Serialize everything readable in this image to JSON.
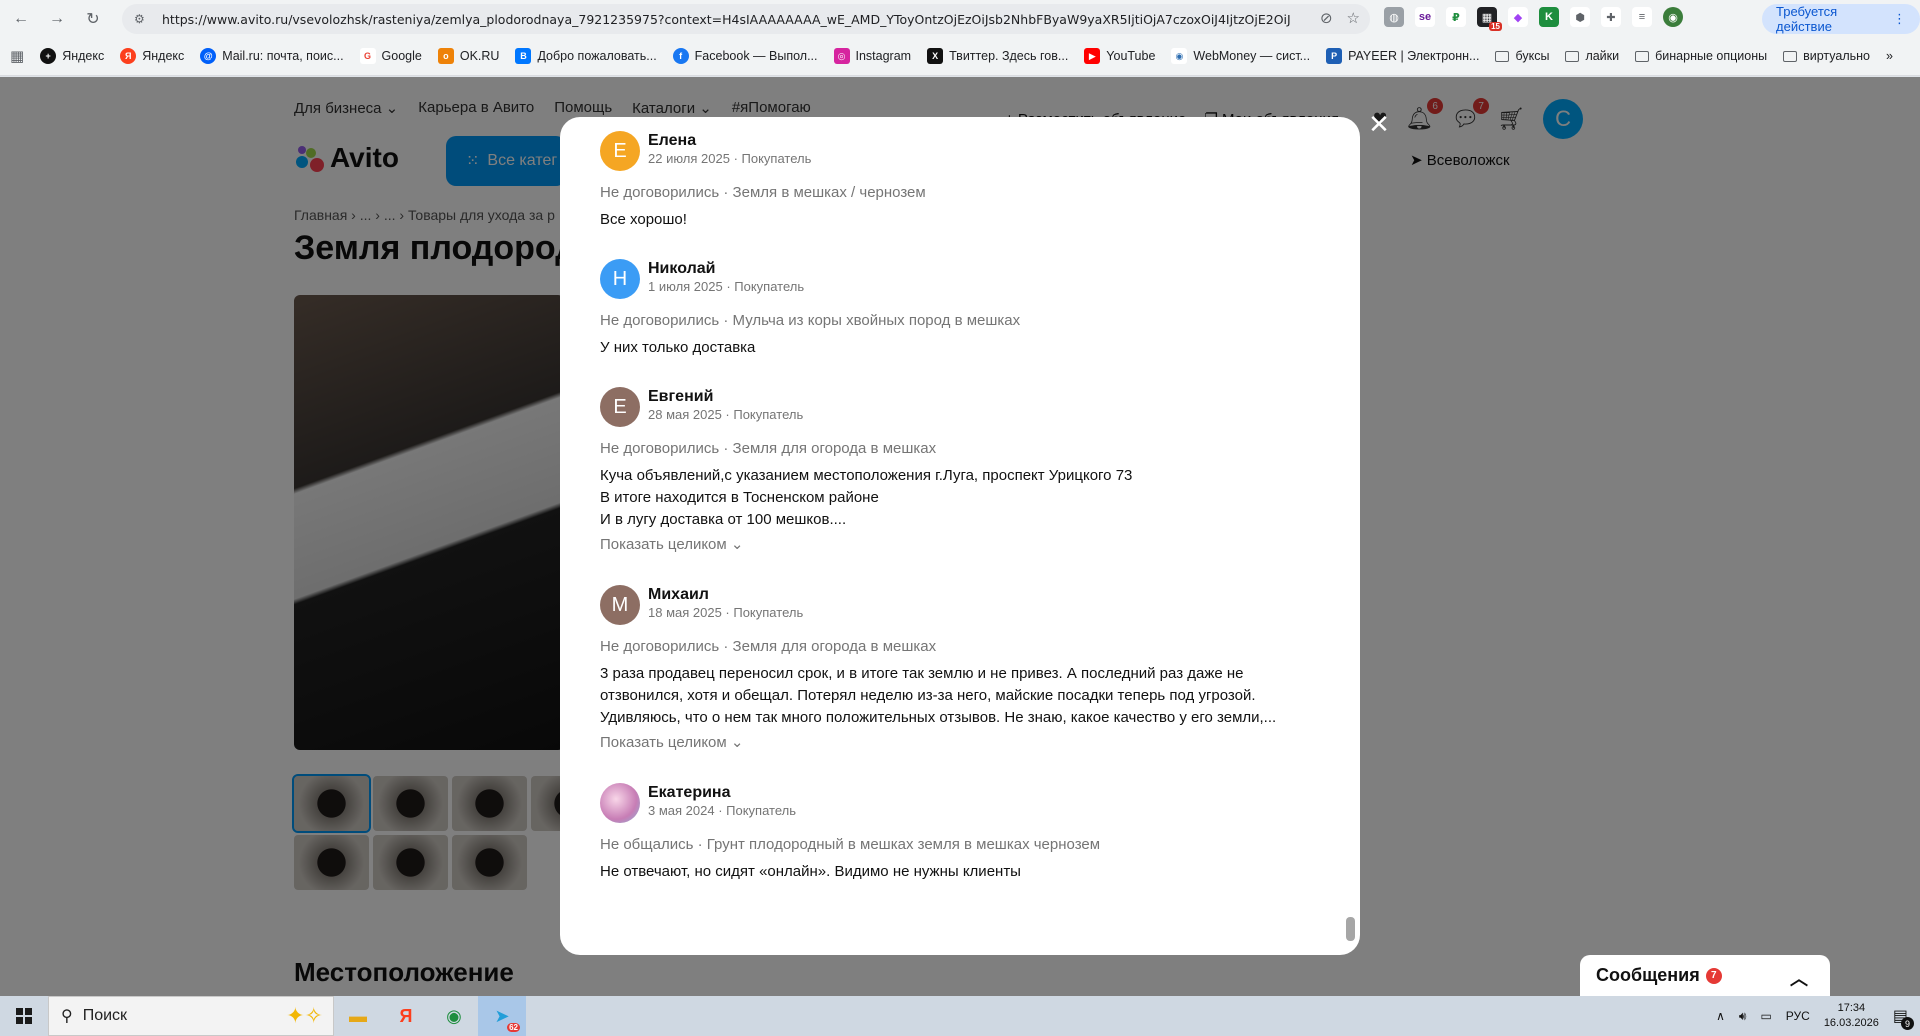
{
  "browser": {
    "url": "https://www.avito.ru/vsevolozhsk/rasteniya/zemlya_plodorodnaya_7921235975?context=H4sIAAAAAAAA_wE_AMD_YToyOntzOjEzOiJsb2NhbFByaW9yaXR5IjtiOjA7czoxOiJ4IjtzOjE2OiJ...",
    "action_label": "Требуется действие",
    "bookmarks": [
      "Яндекс",
      "Яндекс",
      "Mail.ru: почта, поис...",
      "Google",
      "OK.RU",
      "Добро пожаловать...",
      "Facebook — Выпол...",
      "Instagram",
      "Твиттер. Здесь гов...",
      "YouTube",
      "WebMoney — сист...",
      "PAYEER | Электронн...",
      "буксы",
      "лайки",
      "бинарные опционы",
      "виртуально"
    ],
    "ext_badge_1": "15"
  },
  "page": {
    "topnav": [
      "Для бизнеса ⌄",
      "Карьера в Авито",
      "Помощь",
      "Каталоги ⌄",
      "#яПомогаю"
    ],
    "post_ad": "+ Разместить объявление",
    "my_ads": "❐ Мои объявления",
    "notif_count": "6",
    "msg_count": "7",
    "user_initial": "C",
    "logo": "Avito",
    "categories": "Все катег",
    "location": "➤ Всеволожск",
    "breadcrumbs": "Главная › ... › ... › Товары для ухода за р",
    "title": "Земля плодород",
    "location_heading": "Местоположение"
  },
  "reviews": [
    {
      "initial": "Е",
      "color": "#f5a623",
      "name": "Елена",
      "meta": "22 июля 2025 · Покупатель",
      "deal": "Не договорились · Земля в мешках / чернозем",
      "text": [
        "Все хорошо!"
      ],
      "more": ""
    },
    {
      "initial": "Н",
      "color": "#3b9cf5",
      "name": "Николай",
      "meta": "1 июля 2025 · Покупатель",
      "deal": "Не договорились · Мульча из коры хвойных пород в мешках",
      "text": [
        "У них только доставка"
      ],
      "more": ""
    },
    {
      "initial": "Е",
      "color": "#8d6e63",
      "name": "Евгений",
      "meta": "28 мая 2025 · Покупатель",
      "deal": "Не договорились · Земля для огорода в мешках",
      "text": [
        "Куча объявлений,с указанием местоположения г.Луга, проспект Урицкого 73",
        "В итоге находится в Тосненском районе",
        "И в лугу доставка от 100 мешков...."
      ],
      "more": "Показать целиком ⌄"
    },
    {
      "initial": "М",
      "color": "#8d6e63",
      "name": "Михаил",
      "meta": "18 мая 2025 · Покупатель",
      "deal": "Не договорились · Земля для огорода в мешках",
      "text": [
        "3 раза продавец переносил срок, и в итоге так землю и не привез. А последний раз даже не",
        "отзвонился, хотя и обещал. Потерял неделю из-за него, майские посадки теперь под угрозой.",
        "Удивляюсь, что о нем так много положительных отзывов. Не знаю, какое качество у его земли,..."
      ],
      "more": "Показать целиком ⌄"
    },
    {
      "initial": "",
      "color": "#e6a8c8",
      "name": "Екатерина",
      "meta": "3 мая 2024 · Покупатель",
      "deal": "Не общались · Грунт плодородный в мешках земля в мешках чернозем",
      "text": [
        "Не отвечают, но сидят «онлайн». Видимо не нужны клиенты"
      ],
      "more": ""
    }
  ],
  "messages_widget": {
    "label": "Сообщения",
    "count": "7"
  },
  "taskbar": {
    "search_label": "Поиск",
    "lang": "РУС",
    "time": "17:34",
    "date": "16.03.2026",
    "notif": "9",
    "telegram_badge": "62"
  }
}
